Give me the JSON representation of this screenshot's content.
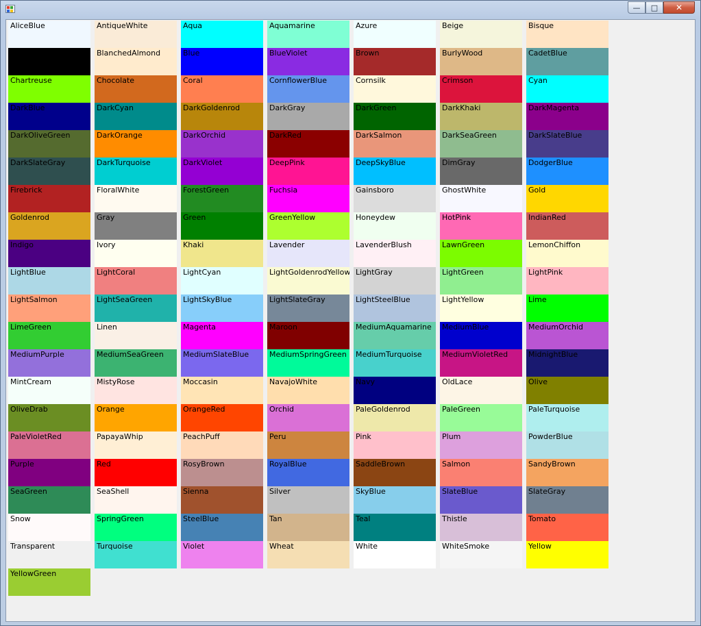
{
  "window": {
    "title": ""
  },
  "colors": [
    {
      "name": "AliceBlue",
      "hex": "#F0F8FF"
    },
    {
      "name": "AntiqueWhite",
      "hex": "#FAEBD7"
    },
    {
      "name": "Aqua",
      "hex": "#00FFFF"
    },
    {
      "name": "Aquamarine",
      "hex": "#7FFFD4"
    },
    {
      "name": "Azure",
      "hex": "#F0FFFF"
    },
    {
      "name": "Beige",
      "hex": "#F5F5DC"
    },
    {
      "name": "Bisque",
      "hex": "#FFE4C4"
    },
    {
      "name": "Black",
      "hex": "#000000"
    },
    {
      "name": "BlanchedAlmond",
      "hex": "#FFEBCD"
    },
    {
      "name": "Blue",
      "hex": "#0000FF"
    },
    {
      "name": "BlueViolet",
      "hex": "#8A2BE2"
    },
    {
      "name": "Brown",
      "hex": "#A52A2A"
    },
    {
      "name": "BurlyWood",
      "hex": "#DEB887"
    },
    {
      "name": "CadetBlue",
      "hex": "#5F9EA0"
    },
    {
      "name": "Chartreuse",
      "hex": "#7FFF00"
    },
    {
      "name": "Chocolate",
      "hex": "#D2691E"
    },
    {
      "name": "Coral",
      "hex": "#FF7F50"
    },
    {
      "name": "CornflowerBlue",
      "hex": "#6495ED"
    },
    {
      "name": "Cornsilk",
      "hex": "#FFF8DC"
    },
    {
      "name": "Crimson",
      "hex": "#DC143C"
    },
    {
      "name": "Cyan",
      "hex": "#00FFFF"
    },
    {
      "name": "DarkBlue",
      "hex": "#00008B"
    },
    {
      "name": "DarkCyan",
      "hex": "#008B8B"
    },
    {
      "name": "DarkGoldenrod",
      "hex": "#B8860B"
    },
    {
      "name": "DarkGray",
      "hex": "#A9A9A9"
    },
    {
      "name": "DarkGreen",
      "hex": "#006400"
    },
    {
      "name": "DarkKhaki",
      "hex": "#BDB76B"
    },
    {
      "name": "DarkMagenta",
      "hex": "#8B008B"
    },
    {
      "name": "DarkOliveGreen",
      "hex": "#556B2F"
    },
    {
      "name": "DarkOrange",
      "hex": "#FF8C00"
    },
    {
      "name": "DarkOrchid",
      "hex": "#9932CC"
    },
    {
      "name": "DarkRed",
      "hex": "#8B0000"
    },
    {
      "name": "DarkSalmon",
      "hex": "#E9967A"
    },
    {
      "name": "DarkSeaGreen",
      "hex": "#8FBC8F"
    },
    {
      "name": "DarkSlateBlue",
      "hex": "#483D8B"
    },
    {
      "name": "DarkSlateGray",
      "hex": "#2F4F4F"
    },
    {
      "name": "DarkTurquoise",
      "hex": "#00CED1"
    },
    {
      "name": "DarkViolet",
      "hex": "#9400D3"
    },
    {
      "name": "DeepPink",
      "hex": "#FF1493"
    },
    {
      "name": "DeepSkyBlue",
      "hex": "#00BFFF"
    },
    {
      "name": "DimGray",
      "hex": "#696969"
    },
    {
      "name": "DodgerBlue",
      "hex": "#1E90FF"
    },
    {
      "name": "Firebrick",
      "hex": "#B22222"
    },
    {
      "name": "FloralWhite",
      "hex": "#FFFAF0"
    },
    {
      "name": "ForestGreen",
      "hex": "#228B22"
    },
    {
      "name": "Fuchsia",
      "hex": "#FF00FF"
    },
    {
      "name": "Gainsboro",
      "hex": "#DCDCDC"
    },
    {
      "name": "GhostWhite",
      "hex": "#F8F8FF"
    },
    {
      "name": "Gold",
      "hex": "#FFD700"
    },
    {
      "name": "Goldenrod",
      "hex": "#DAA520"
    },
    {
      "name": "Gray",
      "hex": "#808080"
    },
    {
      "name": "Green",
      "hex": "#008000"
    },
    {
      "name": "GreenYellow",
      "hex": "#ADFF2F"
    },
    {
      "name": "Honeydew",
      "hex": "#F0FFF0"
    },
    {
      "name": "HotPink",
      "hex": "#FF69B4"
    },
    {
      "name": "IndianRed",
      "hex": "#CD5C5C"
    },
    {
      "name": "Indigo",
      "hex": "#4B0082"
    },
    {
      "name": "Ivory",
      "hex": "#FFFFF0"
    },
    {
      "name": "Khaki",
      "hex": "#F0E68C"
    },
    {
      "name": "Lavender",
      "hex": "#E6E6FA"
    },
    {
      "name": "LavenderBlush",
      "hex": "#FFF0F5"
    },
    {
      "name": "LawnGreen",
      "hex": "#7CFC00"
    },
    {
      "name": "LemonChiffon",
      "hex": "#FFFACD"
    },
    {
      "name": "LightBlue",
      "hex": "#ADD8E6"
    },
    {
      "name": "LightCoral",
      "hex": "#F08080"
    },
    {
      "name": "LightCyan",
      "hex": "#E0FFFF"
    },
    {
      "name": "LightGoldenrodYellow",
      "hex": "#FAFAD2"
    },
    {
      "name": "LightGray",
      "hex": "#D3D3D3"
    },
    {
      "name": "LightGreen",
      "hex": "#90EE90"
    },
    {
      "name": "LightPink",
      "hex": "#FFB6C1"
    },
    {
      "name": "LightSalmon",
      "hex": "#FFA07A"
    },
    {
      "name": "LightSeaGreen",
      "hex": "#20B2AA"
    },
    {
      "name": "LightSkyBlue",
      "hex": "#87CEFA"
    },
    {
      "name": "LightSlateGray",
      "hex": "#778899"
    },
    {
      "name": "LightSteelBlue",
      "hex": "#B0C4DE"
    },
    {
      "name": "LightYellow",
      "hex": "#FFFFE0"
    },
    {
      "name": "Lime",
      "hex": "#00FF00"
    },
    {
      "name": "LimeGreen",
      "hex": "#32CD32"
    },
    {
      "name": "Linen",
      "hex": "#FAF0E6"
    },
    {
      "name": "Magenta",
      "hex": "#FF00FF"
    },
    {
      "name": "Maroon",
      "hex": "#800000"
    },
    {
      "name": "MediumAquamarine",
      "hex": "#66CDAA"
    },
    {
      "name": "MediumBlue",
      "hex": "#0000CD"
    },
    {
      "name": "MediumOrchid",
      "hex": "#BA55D3"
    },
    {
      "name": "MediumPurple",
      "hex": "#9370DB"
    },
    {
      "name": "MediumSeaGreen",
      "hex": "#3CB371"
    },
    {
      "name": "MediumSlateBlue",
      "hex": "#7B68EE"
    },
    {
      "name": "MediumSpringGreen",
      "hex": "#00FA9A"
    },
    {
      "name": "MediumTurquoise",
      "hex": "#48D1CC"
    },
    {
      "name": "MediumVioletRed",
      "hex": "#C71585"
    },
    {
      "name": "MidnightBlue",
      "hex": "#191970"
    },
    {
      "name": "MintCream",
      "hex": "#F5FFFA"
    },
    {
      "name": "MistyRose",
      "hex": "#FFE4E1"
    },
    {
      "name": "Moccasin",
      "hex": "#FFE4B5"
    },
    {
      "name": "NavajoWhite",
      "hex": "#FFDEAD"
    },
    {
      "name": "Navy",
      "hex": "#000080"
    },
    {
      "name": "OldLace",
      "hex": "#FDF5E6"
    },
    {
      "name": "Olive",
      "hex": "#808000"
    },
    {
      "name": "OliveDrab",
      "hex": "#6B8E23"
    },
    {
      "name": "Orange",
      "hex": "#FFA500"
    },
    {
      "name": "OrangeRed",
      "hex": "#FF4500"
    },
    {
      "name": "Orchid",
      "hex": "#DA70D6"
    },
    {
      "name": "PaleGoldenrod",
      "hex": "#EEE8AA"
    },
    {
      "name": "PaleGreen",
      "hex": "#98FB98"
    },
    {
      "name": "PaleTurquoise",
      "hex": "#AFEEEE"
    },
    {
      "name": "PaleVioletRed",
      "hex": "#DB7093"
    },
    {
      "name": "PapayaWhip",
      "hex": "#FFEFD5"
    },
    {
      "name": "PeachPuff",
      "hex": "#FFDAB9"
    },
    {
      "name": "Peru",
      "hex": "#CD853F"
    },
    {
      "name": "Pink",
      "hex": "#FFC0CB"
    },
    {
      "name": "Plum",
      "hex": "#DDA0DD"
    },
    {
      "name": "PowderBlue",
      "hex": "#B0E0E6"
    },
    {
      "name": "Purple",
      "hex": "#800080"
    },
    {
      "name": "Red",
      "hex": "#FF0000"
    },
    {
      "name": "RosyBrown",
      "hex": "#BC8F8F"
    },
    {
      "name": "RoyalBlue",
      "hex": "#4169E1"
    },
    {
      "name": "SaddleBrown",
      "hex": "#8B4513"
    },
    {
      "name": "Salmon",
      "hex": "#FA8072"
    },
    {
      "name": "SandyBrown",
      "hex": "#F4A460"
    },
    {
      "name": "SeaGreen",
      "hex": "#2E8B57"
    },
    {
      "name": "SeaShell",
      "hex": "#FFF5EE"
    },
    {
      "name": "Sienna",
      "hex": "#A0522D"
    },
    {
      "name": "Silver",
      "hex": "#C0C0C0"
    },
    {
      "name": "SkyBlue",
      "hex": "#87CEEB"
    },
    {
      "name": "SlateBlue",
      "hex": "#6A5ACD"
    },
    {
      "name": "SlateGray",
      "hex": "#708090"
    },
    {
      "name": "Snow",
      "hex": "#FFFAFA"
    },
    {
      "name": "SpringGreen",
      "hex": "#00FF7F"
    },
    {
      "name": "SteelBlue",
      "hex": "#4682B4"
    },
    {
      "name": "Tan",
      "hex": "#D2B48C"
    },
    {
      "name": "Teal",
      "hex": "#008080"
    },
    {
      "name": "Thistle",
      "hex": "#D8BFD8"
    },
    {
      "name": "Tomato",
      "hex": "#FF6347"
    },
    {
      "name": "Transparent",
      "hex": "#F0F0F0"
    },
    {
      "name": "Turquoise",
      "hex": "#40E0D0"
    },
    {
      "name": "Violet",
      "hex": "#EE82EE"
    },
    {
      "name": "Wheat",
      "hex": "#F5DEB3"
    },
    {
      "name": "White",
      "hex": "#FFFFFF"
    },
    {
      "name": "WhiteSmoke",
      "hex": "#F5F5F5"
    },
    {
      "name": "Yellow",
      "hex": "#FFFF00"
    },
    {
      "name": "YellowGreen",
      "hex": "#9ACD32"
    }
  ]
}
